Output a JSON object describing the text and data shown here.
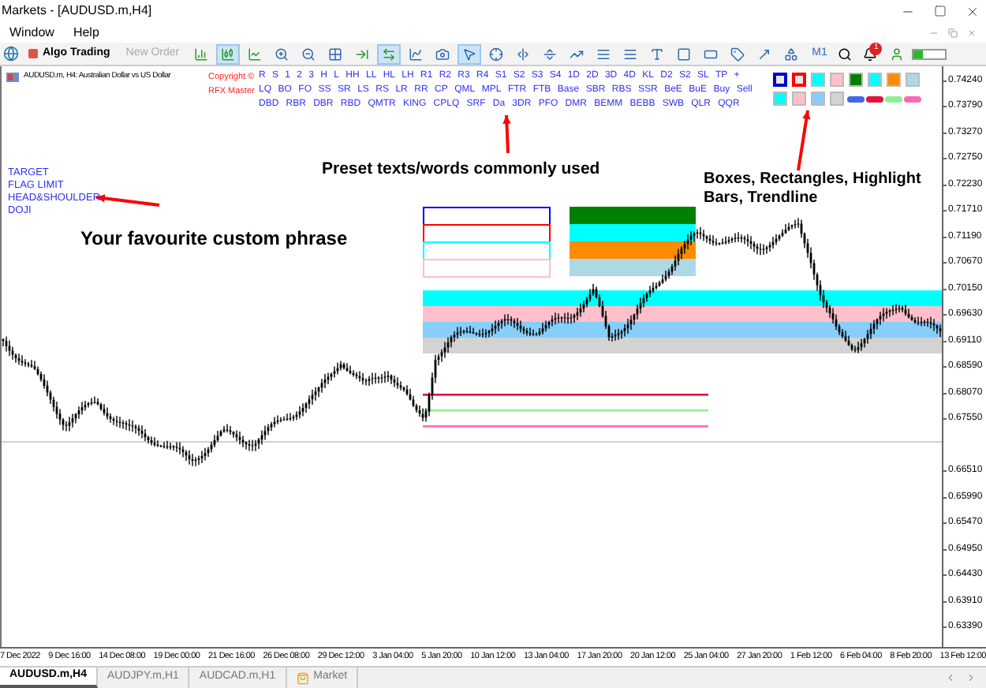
{
  "window": {
    "title": "Markets - [AUDUSD.m,H4]"
  },
  "menu": [
    "Window",
    "Help"
  ],
  "toolbar": {
    "algo_trading": "Algo Trading",
    "new_order": {
      "label": "New Order",
      "disabled": true
    },
    "timeframe": "M1",
    "notification_count": "1",
    "tools": [
      {
        "kind": "bars",
        "selected": false
      },
      {
        "kind": "candles",
        "selected": true
      },
      {
        "kind": "line",
        "selected": false
      },
      {
        "kind": "zoom-in",
        "selected": false
      },
      {
        "kind": "zoom-out",
        "selected": false
      },
      {
        "kind": "grid",
        "selected": false
      },
      {
        "kind": "scroll-end",
        "selected": false
      },
      {
        "kind": "autoscroll",
        "selected": true
      },
      {
        "kind": "indicators",
        "selected": false
      },
      {
        "kind": "screenshot",
        "selected": false
      },
      {
        "kind": "cursor",
        "selected": true
      },
      {
        "kind": "crosshair",
        "selected": false
      },
      {
        "kind": "vline",
        "selected": false
      },
      {
        "kind": "hline",
        "selected": false
      },
      {
        "kind": "trendline",
        "selected": false
      },
      {
        "kind": "channel",
        "selected": false
      },
      {
        "kind": "fibo",
        "selected": false
      },
      {
        "kind": "text",
        "selected": false
      },
      {
        "kind": "rectangle",
        "selected": false
      },
      {
        "kind": "label",
        "selected": false
      },
      {
        "kind": "price-label",
        "selected": false
      },
      {
        "kind": "arrow",
        "selected": false
      },
      {
        "kind": "shapes",
        "selected": false
      }
    ]
  },
  "chart": {
    "symbol": "AUDUSD.m, H4: Australian Dollar vs US Dollar",
    "copyright": [
      "Copyright ©",
      "RFX Master"
    ],
    "label_rows": [
      [
        "R",
        "S",
        "1",
        "2",
        "3",
        "H",
        "L",
        "HH",
        "LL",
        "HL",
        "LH",
        "R1",
        "R2",
        "R3",
        "R4",
        "S1",
        "S2",
        "S3",
        "S4",
        "1D",
        "2D",
        "3D",
        "4D",
        "KL",
        "D2",
        "S2",
        "SL",
        "TP",
        "+"
      ],
      [
        "LQ",
        "BO",
        "FO",
        "SS",
        "SR",
        "LS",
        "RS",
        "LR",
        "RR",
        "CP",
        "QML",
        "MPL",
        "FTR",
        "FTB",
        "Base",
        "SBR",
        "RBS",
        "SSR",
        "BeE",
        "BuE",
        "Buy",
        "Sell"
      ],
      [
        "DBD",
        "RBR",
        "DBR",
        "RBD",
        "QMTR",
        "KING",
        "CPLQ",
        "SRF",
        "Da",
        "3DR",
        "PFO",
        "DMR",
        "BEMM",
        "BEBB",
        "SWB",
        "QLR",
        "QQR"
      ]
    ],
    "palette": [
      [
        {
          "kind": "outline",
          "color": "#0000cc"
        },
        {
          "kind": "outline",
          "color": "#ff0000"
        },
        {
          "kind": "fill",
          "color": "#00ffff"
        },
        {
          "kind": "fill",
          "color": "#ffc0cb"
        },
        {
          "kind": "fill",
          "color": "#008000"
        },
        {
          "kind": "fill",
          "color": "#00ffff"
        },
        {
          "kind": "fill",
          "color": "#ff8c00"
        },
        {
          "kind": "fill",
          "color": "#add8e6"
        }
      ],
      [
        {
          "kind": "fill",
          "color": "#00ffff"
        },
        {
          "kind": "fill",
          "color": "#ffc0cb"
        },
        {
          "kind": "fill",
          "color": "#87cefa"
        },
        {
          "kind": "fill",
          "color": "#d3d3d3"
        },
        {
          "kind": "line",
          "color": "#4169e1"
        },
        {
          "kind": "line",
          "color": "#dc143c"
        },
        {
          "kind": "line",
          "color": "#90ee90"
        },
        {
          "kind": "line",
          "color": "#ff69b4"
        }
      ]
    ],
    "custom_phrases": [
      "TARGET",
      "FLAG LIMIT",
      "HEAD&SHOULDER",
      "DOJI"
    ],
    "annotations": [
      "Your favourite custom phrase",
      "Preset texts/words commonly used",
      "Boxes, Rectangles, Highlight Bars, Trendline"
    ],
    "outline_boxes": [
      {
        "color": "#0000ff"
      },
      {
        "color": "#ff0000"
      },
      {
        "color": "#00ffff"
      },
      {
        "color": "#ffc0cb"
      }
    ],
    "filled_boxes": [
      {
        "color": "#008000"
      },
      {
        "color": "#00ffff"
      },
      {
        "color": "#ff8c00"
      },
      {
        "color": "#add8e6"
      }
    ],
    "highlight_bars": [
      {
        "color": "#00ffff"
      },
      {
        "color": "#ffc0cb"
      },
      {
        "color": "#87cefa"
      },
      {
        "color": "#d3d3d3"
      }
    ],
    "trendlines": [
      {
        "color": "#dc143c"
      },
      {
        "color": "#90ee90"
      },
      {
        "color": "#ff69b4"
      }
    ],
    "price_axis": [
      "0.74240",
      "0.73790",
      "0.73270",
      "0.72750",
      "0.72230",
      "0.71710",
      "0.71190",
      "0.70670",
      "0.70150",
      "0.69630",
      "0.69110",
      "0.68590",
      "0.68070",
      "0.67550",
      "0.66510",
      "0.65990",
      "0.65470",
      "0.64950",
      "0.64430",
      "0.63910",
      "0.63390"
    ],
    "time_axis": [
      "7 Dec 2022",
      "9 Dec 16:00",
      "14 Dec 08:00",
      "19 Dec 00:00",
      "21 Dec 16:00",
      "26 Dec 08:00",
      "29 Dec 12:00",
      "3 Jan 04:00",
      "5 Jan 20:00",
      "10 Jan 12:00",
      "13 Jan 04:00",
      "17 Jan 20:00",
      "20 Jan 12:00",
      "25 Jan 04:00",
      "27 Jan 20:00",
      "1 Feb 12:00",
      "6 Feb 04:00",
      "8 Feb 20:00",
      "13 Feb 12:00"
    ]
  },
  "tabs": [
    {
      "label": "AUDUSD.m,H4",
      "selected": true
    },
    {
      "label": "AUDJPY.m,H1",
      "selected": false
    },
    {
      "label": "AUDCAD.m,H1",
      "selected": false
    },
    {
      "label": "Market",
      "selected": false,
      "kind": "market"
    }
  ]
}
